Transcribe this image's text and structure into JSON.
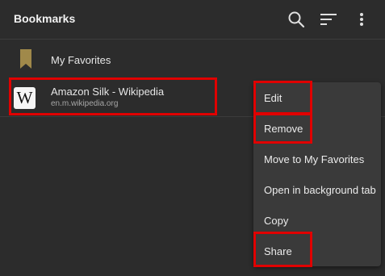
{
  "header": {
    "title": "Bookmarks",
    "icons": [
      "search-icon",
      "sort-icon",
      "more-vert-icon"
    ]
  },
  "favorites": {
    "label": "My Favorites",
    "icon": "bookmark-icon",
    "icon_color": "#a0894a"
  },
  "bookmark": {
    "title": "Amazon Silk - Wikipedia",
    "url": "en.m.wikipedia.org",
    "icon": "wikipedia-icon",
    "icon_letter": "W"
  },
  "context_menu": {
    "items": [
      {
        "label": "Edit",
        "highlighted": true
      },
      {
        "label": "Remove",
        "highlighted": true
      },
      {
        "label": "Move to My Favorites",
        "highlighted": false
      },
      {
        "label": "Open in background tab",
        "highlighted": false
      },
      {
        "label": "Copy",
        "highlighted": false
      },
      {
        "label": "Share",
        "highlighted": true
      }
    ]
  },
  "colors": {
    "background": "#2c2c2c",
    "menu_background": "#3a3a3a",
    "highlight_box": "#e00000"
  }
}
